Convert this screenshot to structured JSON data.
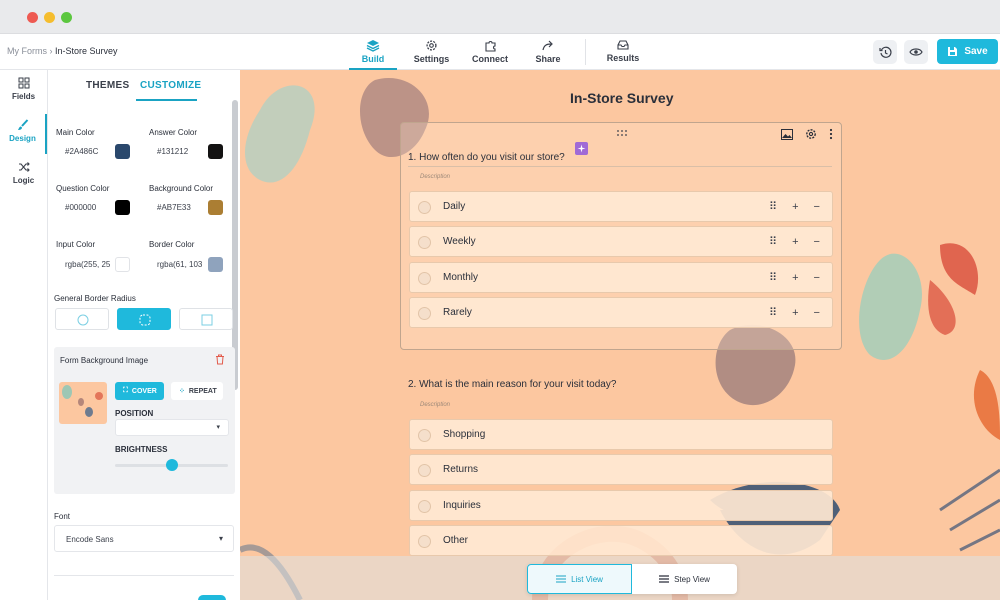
{
  "window": {
    "controls": [
      "close",
      "minimize",
      "maximize"
    ]
  },
  "breadcrumb": {
    "root": "My Forms",
    "separator": "›",
    "current": "In-Store Survey"
  },
  "nav": {
    "tabs": [
      {
        "label": "Build",
        "icon": "layers-icon",
        "active": true
      },
      {
        "label": "Settings",
        "icon": "gear-icon"
      },
      {
        "label": "Connect",
        "icon": "puzzle-icon"
      },
      {
        "label": "Share",
        "icon": "share-arrow-icon"
      },
      {
        "label": "Results",
        "icon": "inbox-icon"
      }
    ],
    "save_label": "Save"
  },
  "rail": {
    "items": [
      {
        "label": "Fields",
        "icon": "grid-icon"
      },
      {
        "label": "Design",
        "icon": "brush-icon",
        "active": true
      },
      {
        "label": "Logic",
        "icon": "shuffle-icon"
      }
    ]
  },
  "panel": {
    "tabs": [
      "THEMES",
      "CUSTOMIZE"
    ],
    "colors": {
      "main": {
        "label": "Main Color",
        "value": "#2A486C",
        "swatch": "#2a486c"
      },
      "answer": {
        "label": "Answer Color",
        "value": "#131212",
        "swatch": "#131212"
      },
      "question": {
        "label": "Question Color",
        "value": "#000000",
        "swatch": "#000000"
      },
      "background": {
        "label": "Background Color",
        "value": "#AB7E33",
        "swatch": "#ab7e33"
      },
      "input": {
        "label": "Input Color",
        "value": "rgba(255, 25",
        "swatch": "#ffffff"
      },
      "border": {
        "label": "Border Color",
        "value": "rgba(61, 103",
        "swatch": "#8fa3bd"
      }
    },
    "border_radius_label": "General Border Radius",
    "bg_image": {
      "label": "Form Background Image",
      "cover_label": "COVER",
      "repeat_label": "REPEAT",
      "position_label": "POSITION",
      "brightness_label": "BRIGHTNESS",
      "brightness": 0.5
    },
    "font_label": "Font",
    "font_value": "Encode Sans"
  },
  "survey": {
    "title": "In-Store Survey",
    "questions": [
      {
        "text": "1. How often do you visit our store?",
        "description": "Description",
        "options": [
          "Daily",
          "Weekly",
          "Monthly",
          "Rarely"
        ]
      },
      {
        "text": "2. What is the main reason for your visit today?",
        "description": "Description",
        "options": [
          "Shopping",
          "Returns",
          "Inquiries",
          "Other"
        ]
      }
    ],
    "option_controls": "⠿ + −"
  },
  "view_toggle": {
    "list_label": "List View",
    "step_label": "Step View"
  },
  "accent": "#1fb9dc",
  "canvas_bg": "#fcc7a0"
}
